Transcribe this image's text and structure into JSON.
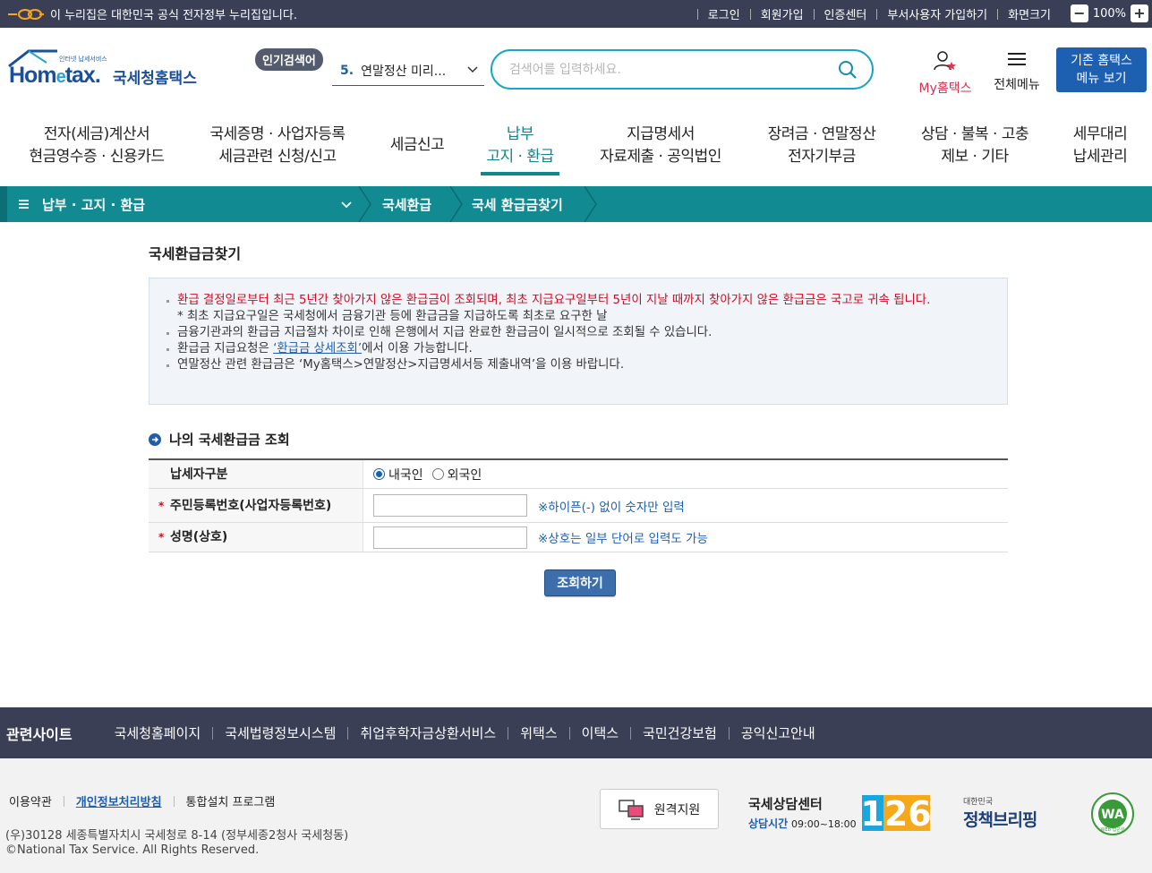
{
  "gov_bar": {
    "text": "이 누리집은 대한민국 공식 전자정부 누리집입니다.",
    "links": [
      "로그인",
      "회원가입",
      "인증센터",
      "부서사용자 가입하기",
      "화면크기"
    ],
    "zoom": "100%"
  },
  "header": {
    "logo_tag": "인터넷 납세서비스",
    "logo_en_a": "Hom",
    "logo_en_e": "e",
    "logo_en_b": "tax.",
    "logo_kr": "국세청홈택스",
    "popular_badge": "인기검색어",
    "popular_num": "5.",
    "popular_text": "연말정산 미리...",
    "search_placeholder": "검색어를 입력하세요.",
    "my_home": "My홈택스",
    "all_menu": "전체메뉴",
    "old_menu_1": "기존 홈택스",
    "old_menu_2": "메뉴 보기"
  },
  "gnb": [
    {
      "l1": "전자(세금)계산서",
      "l2": "현금영수증 · 신용카드"
    },
    {
      "l1": "국세증명 · 사업자등록",
      "l2": "세금관련 신청/신고"
    },
    {
      "l1": "세금신고",
      "l2": ""
    },
    {
      "l1": "납부",
      "l2": "고지 · 환급"
    },
    {
      "l1": "지급명세서",
      "l2": "자료제출 · 공익법인"
    },
    {
      "l1": "장려금 · 연말정산",
      "l2": "전자기부금"
    },
    {
      "l1": "상담 · 불복 · 고충",
      "l2": "제보 · 기타"
    },
    {
      "l1": "세무대리",
      "l2": "납세관리"
    }
  ],
  "breadcrumb": {
    "menu": "납부 · 고지 · 환급",
    "level2": "국세환급",
    "level3": "국세 환급금찾기"
  },
  "page": {
    "title": "국세환급금찾기",
    "notice_1": "환급 결정일로부터 최근 5년간 찾아가지 않은 환급금이 조회되며, 최초 지급요구일부터 5년이 지날 때까지 찾아가지 않은 환급금은 국고로 귀속",
    "notice_1b": "됩니다.",
    "notice_sub": "* 최초 지급요구일은 국세청에서 금융기관 등에 환급금을 지급하도록 최초로 요구한 날",
    "notice_2": "금융기관과의 환급금 지급절차 차이로 인해 은행에서 지급 완료한 환급금이 일시적으로 조회될 수 있습니다.",
    "notice_3_pre": "환급금 지급요청은 ",
    "notice_3_link": "‘환급금 상세조회’",
    "notice_3_post": "에서 이용 가능합니다.",
    "notice_4": "연말정산 관련 환급금은 ‘My홈택스>연말정산>지급명세서등 제출내역’을 이용 바랍니다.",
    "section_title": "나의 국세환급금 조회",
    "row1_label": "납세자구분",
    "radio_domestic": "내국인",
    "radio_foreign": "외국인",
    "row2_label": "주민등록번호(사업자등록번호)",
    "row2_hint": "※하이픈(-) 없이 숫자만 입력",
    "row3_label": "성명(상호)",
    "row3_hint": "※상호는 일부 단어로 입력도 가능",
    "search_button": "조회하기"
  },
  "related": {
    "title": "관련사이트",
    "links": [
      "국세청홈페이지",
      "국세법령정보시스템",
      "취업후학자금상환서비스",
      "위택스",
      "이택스",
      "국민건강보험",
      "공익신고안내"
    ]
  },
  "footer": {
    "links": [
      "이용약관",
      "개인정보처리방침",
      "통합설치 프로그램"
    ],
    "address": "(우)30128 세종특별자치시 국세청로 8-14 (정부세종2청사 국세청동)",
    "copyright": "©National Tax Service. All Rights Reserved.",
    "remote": "원격지원",
    "cc_title": "국세상담센터",
    "cc_hours_label": "상담시간",
    "cc_hours": "09:00~18:00",
    "cc_number": "126",
    "policy_small": "대한민국",
    "policy_big": "정책브리핑",
    "wa_text": "WA",
    "wa_sub": "WEB 접근성"
  },
  "colors": {
    "gov_bar": "#3a3f56",
    "teal": "#128a92",
    "brand_blue": "#1d5fb1",
    "red": "#d10a1e"
  }
}
